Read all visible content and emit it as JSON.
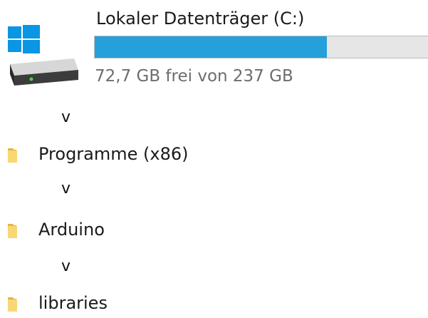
{
  "drive": {
    "title": "Lokaler Datenträger (C:)",
    "free_text": "72,7 GB frei von 237 GB",
    "used_fraction": 0.693,
    "bar_fill_color": "#26a0da",
    "bar_track_color": "#e6e6e6",
    "icon": "windows-drive-icon"
  },
  "path": {
    "separator": "v",
    "folders": [
      {
        "label": "Programme (x86)",
        "icon": "folder-icon"
      },
      {
        "label": "Arduino",
        "icon": "folder-icon"
      },
      {
        "label": "libraries",
        "icon": "folder-icon"
      }
    ]
  },
  "colors": {
    "folder_yellow": "#f8d775",
    "folder_dark": "#e4b73f",
    "windows_blue": "#0a95e5"
  }
}
